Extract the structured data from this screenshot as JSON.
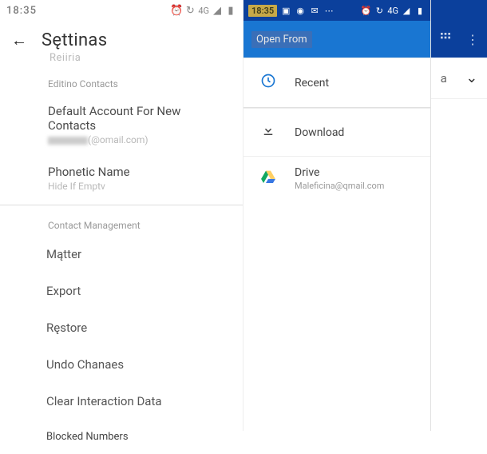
{
  "left": {
    "status": {
      "time": "18:35",
      "network": "4G"
    },
    "title": "Sęttinas",
    "retina": "Reiiria",
    "editing_contacts_header": "Editino Contacts",
    "default_account": {
      "label": "Default Account For New Contacts",
      "suffix": "(@omail.com)"
    },
    "phonetic": {
      "label": "Phonetic Name",
      "sub": "Hide If Emptv"
    },
    "contact_mgmt_header": "Contact Management",
    "actions": {
      "matter": "Mątter",
      "export": "Export",
      "restore": "Ręstore",
      "undo": "Undo Chanaes",
      "clear": "Clear Interaction Data",
      "blocked": "Blocked Numbers"
    }
  },
  "right": {
    "status": {
      "time": "18:35",
      "network": "4G"
    },
    "open_from": "Open From",
    "recent": "Recent",
    "download": "Download",
    "drive": {
      "label": "Drive",
      "email": "Maleficina@qmail.com"
    },
    "side": {
      "letter": "a"
    }
  }
}
